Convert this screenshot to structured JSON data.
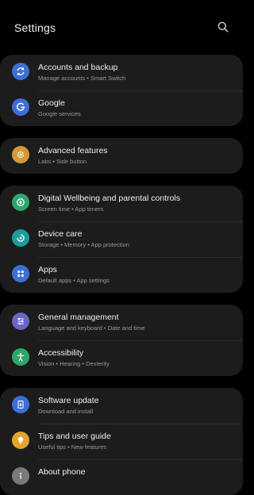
{
  "header": {
    "title": "Settings",
    "search_icon": "search-icon"
  },
  "cards": [
    {
      "items": [
        {
          "title": "Accounts and backup",
          "subtitle": "Manage accounts  •  Smart Switch",
          "icon": "sync-icon",
          "color": "#3d6fd6"
        },
        {
          "title": "Google",
          "subtitle": "Google services",
          "icon": "google-g-icon",
          "color": "#3d6fd6"
        }
      ]
    },
    {
      "items": [
        {
          "title": "Advanced features",
          "subtitle": "Labs  •  Side button",
          "icon": "gear-plus-icon",
          "color": "#d49a3a"
        }
      ]
    },
    {
      "items": [
        {
          "title": "Digital Wellbeing and parental controls",
          "subtitle": "Screen time  •  App timers",
          "icon": "wellbeing-icon",
          "color": "#2ea66a"
        },
        {
          "title": "Device care",
          "subtitle": "Storage  •  Memory  •  App protection",
          "icon": "device-care-icon",
          "color": "#1c9c9a"
        },
        {
          "title": "Apps",
          "subtitle": "Default apps  •  App settings",
          "icon": "apps-grid-icon",
          "color": "#3d6fd6"
        }
      ]
    },
    {
      "items": [
        {
          "title": "General management",
          "subtitle": "Language and keyboard  •  Date and time",
          "icon": "sliders-icon",
          "color": "#6a64c4"
        },
        {
          "title": "Accessibility",
          "subtitle": "Vision  •  Hearing  •  Dexterity",
          "icon": "accessibility-icon",
          "color": "#2ea66a"
        }
      ]
    },
    {
      "items": [
        {
          "title": "Software update",
          "subtitle": "Download and install",
          "icon": "software-update-icon",
          "color": "#3d6fd6"
        },
        {
          "title": "Tips and user guide",
          "subtitle": "Useful tips  •  New features",
          "icon": "lightbulb-icon",
          "color": "#e2a52e"
        },
        {
          "title": "About phone",
          "subtitle": "",
          "icon": "info-icon",
          "color": "#7a7a7a"
        }
      ]
    }
  ]
}
